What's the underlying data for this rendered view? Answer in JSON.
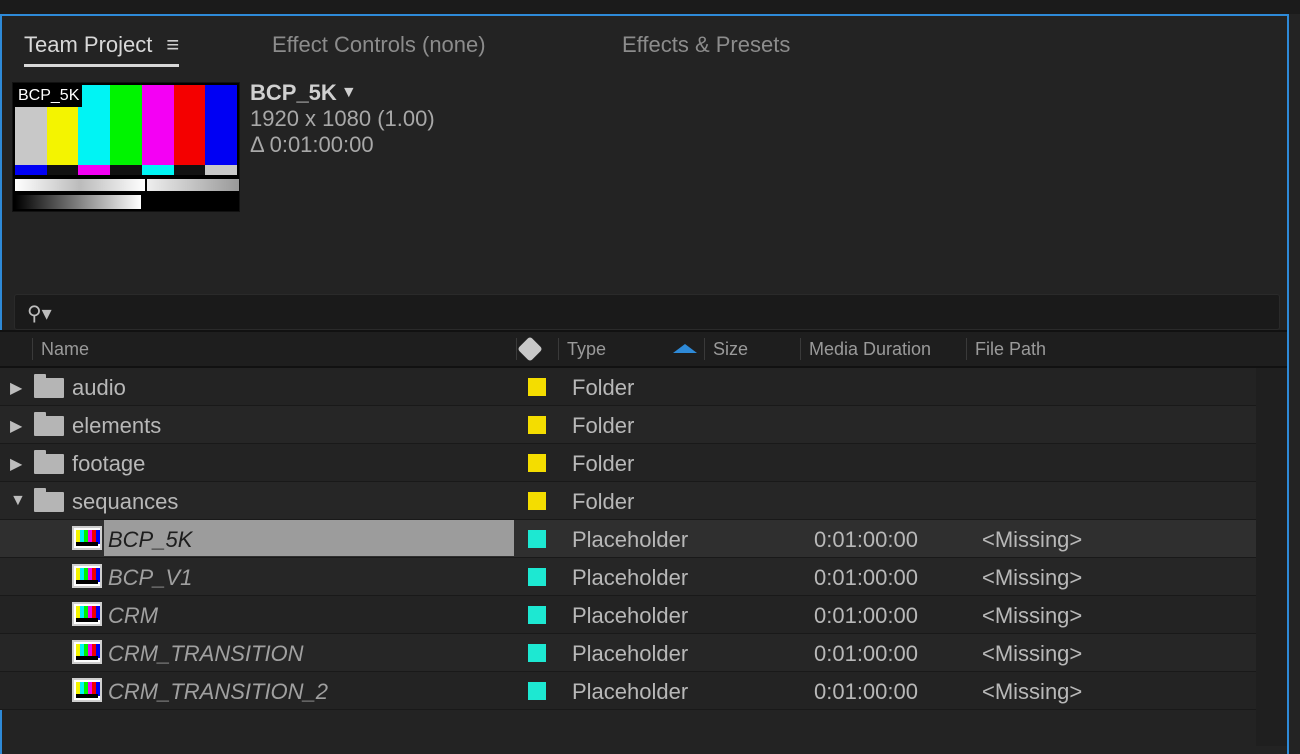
{
  "tabs": {
    "team_project": "Team Project",
    "menu_glyph": "≡",
    "effect_controls": "Effect Controls (none)",
    "effects_presets": "Effects & Presets"
  },
  "preview": {
    "thumb_label": "BCP_5K",
    "title": "BCP_5K",
    "caret": "▼",
    "resolution": "1920 x 1080 (1.00)",
    "duration": "Δ 0:01:00:00"
  },
  "search": {
    "icon": "search-icon",
    "placeholder": ""
  },
  "columns": {
    "name": "Name",
    "label": "label-tag-icon",
    "type": "Type",
    "size": "Size",
    "media_duration": "Media Duration",
    "file_path": "File Path"
  },
  "folders": [
    {
      "name": "audio",
      "type": "Folder",
      "expanded": false,
      "triangle": "▶",
      "label_color": "#f4dd00"
    },
    {
      "name": "elements",
      "type": "Folder",
      "expanded": false,
      "triangle": "▶",
      "label_color": "#f4dd00"
    },
    {
      "name": "footage",
      "type": "Folder",
      "expanded": false,
      "triangle": "▶",
      "label_color": "#f4dd00"
    },
    {
      "name": "sequances",
      "type": "Folder",
      "expanded": true,
      "triangle": "▼",
      "label_color": "#f4dd00"
    }
  ],
  "items": [
    {
      "name": "BCP_5K",
      "type": "Placeholder",
      "duration": "0:01:00:00",
      "path": "<Missing>",
      "label_color": "#1de8d2",
      "selected": true
    },
    {
      "name": "BCP_V1",
      "type": "Placeholder",
      "duration": "0:01:00:00",
      "path": "<Missing>",
      "label_color": "#1de8d2",
      "selected": false
    },
    {
      "name": "CRM",
      "type": "Placeholder",
      "duration": "0:01:00:00",
      "path": "<Missing>",
      "label_color": "#1de8d2",
      "selected": false
    },
    {
      "name": "CRM_TRANSITION",
      "type": "Placeholder",
      "duration": "0:01:00:00",
      "path": "<Missing>",
      "label_color": "#1de8d2",
      "selected": false
    },
    {
      "name": "CRM_TRANSITION_2",
      "type": "Placeholder",
      "duration": "0:01:00:00",
      "path": "<Missing>",
      "label_color": "#1de8d2",
      "selected": false
    }
  ],
  "colors": {
    "accent": "#2e8ad8",
    "folder_label": "#f4dd00",
    "placeholder_label": "#1de8d2"
  }
}
